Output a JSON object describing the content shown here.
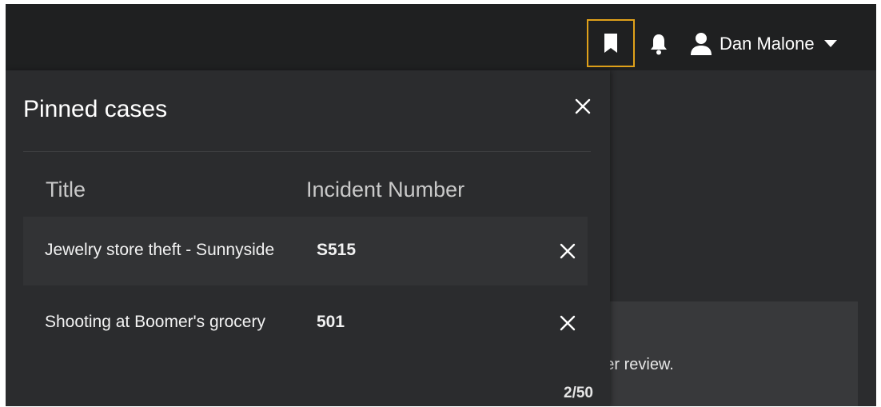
{
  "header": {
    "bookmark_icon": "bookmark-icon",
    "notification_icon": "bell-icon",
    "user": {
      "icon": "user-icon",
      "name": "Dan Malone",
      "caret_icon": "caret-down-icon"
    },
    "accent_color": "#e0a11a"
  },
  "background": {
    "partial_text": "nder review."
  },
  "panel": {
    "title": "Pinned cases",
    "columns": [
      "Title",
      "Incident Number"
    ],
    "rows": [
      {
        "title": "Jewelry store theft - Sunnyside",
        "incident": "S515"
      },
      {
        "title": "Shooting at Boomer's grocery",
        "incident": "501"
      }
    ],
    "count": "2/50"
  }
}
